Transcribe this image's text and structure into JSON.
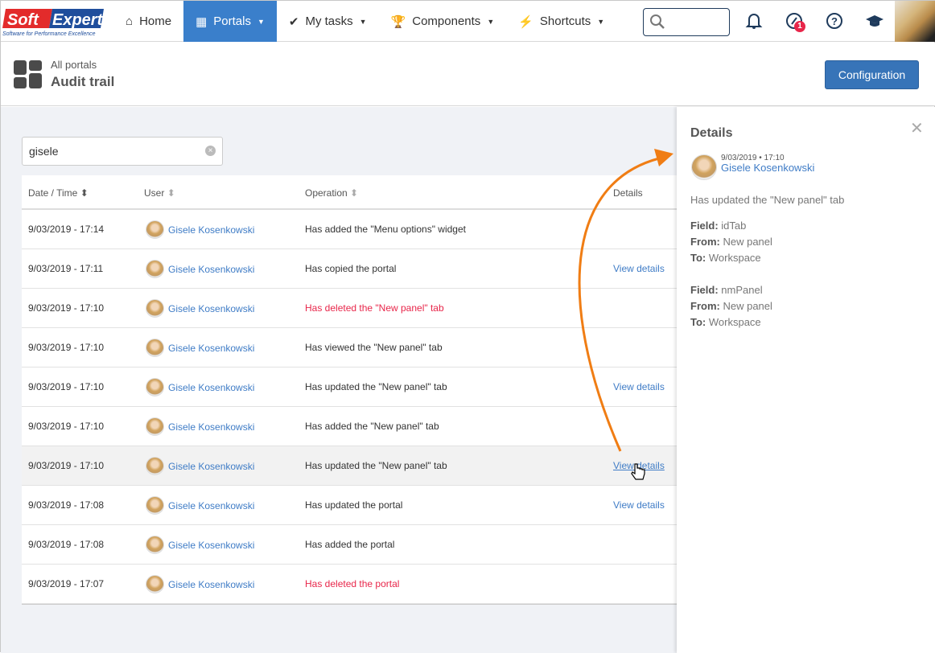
{
  "brand": {
    "logo_text_1": "Soft",
    "logo_text_2": "Expert",
    "tagline": "Software for Performance Excellence"
  },
  "nav": [
    {
      "label": "Home",
      "icon": "home-icon"
    },
    {
      "label": "Portals",
      "icon": "portals-icon",
      "active": true,
      "caret": "▼"
    },
    {
      "label": "My tasks",
      "icon": "check-icon",
      "caret": "▼"
    },
    {
      "label": "Components",
      "icon": "trophy-icon",
      "caret": "▼"
    },
    {
      "label": "Shortcuts",
      "icon": "bolt-icon",
      "caret": "▼"
    }
  ],
  "topbar": {
    "search_placeholder": "",
    "notification_badge": "1"
  },
  "header": {
    "breadcrumb": "All portals",
    "title": "Audit trail",
    "config_button": "Configuration"
  },
  "filter": {
    "value": "gisele"
  },
  "table": {
    "columns": [
      "Date / Time",
      "User",
      "Operation",
      "Details"
    ],
    "rows": [
      {
        "date": "9/03/2019 - 17:14",
        "user": "Gisele Kosenkowski",
        "operation": "Has added the \"Menu options\" widget",
        "details": "",
        "deleted": false
      },
      {
        "date": "9/03/2019 - 17:11",
        "user": "Gisele Kosenkowski",
        "operation": "Has copied the portal",
        "details": "View details",
        "deleted": false
      },
      {
        "date": "9/03/2019 - 17:10",
        "user": "Gisele Kosenkowski",
        "operation": "Has deleted the \"New panel\" tab",
        "details": "",
        "deleted": true
      },
      {
        "date": "9/03/2019 - 17:10",
        "user": "Gisele Kosenkowski",
        "operation": "Has viewed the \"New panel\" tab",
        "details": "",
        "deleted": false
      },
      {
        "date": "9/03/2019 - 17:10",
        "user": "Gisele Kosenkowski",
        "operation": "Has updated the \"New panel\" tab",
        "details": "View details",
        "deleted": false
      },
      {
        "date": "9/03/2019 - 17:10",
        "user": "Gisele Kosenkowski",
        "operation": "Has added the \"New panel\" tab",
        "details": "",
        "deleted": false
      },
      {
        "date": "9/03/2019 - 17:10",
        "user": "Gisele Kosenkowski",
        "operation": "Has updated the \"New panel\" tab",
        "details": "View details",
        "deleted": false,
        "highlighted": true
      },
      {
        "date": "9/03/2019 - 17:08",
        "user": "Gisele Kosenkowski",
        "operation": "Has updated the portal",
        "details": "View details",
        "deleted": false
      },
      {
        "date": "9/03/2019 - 17:08",
        "user": "Gisele Kosenkowski",
        "operation": "Has added the portal",
        "details": "",
        "deleted": false
      },
      {
        "date": "9/03/2019 - 17:07",
        "user": "Gisele Kosenkowski",
        "operation": "Has deleted the portal",
        "details": "",
        "deleted": true
      }
    ]
  },
  "panel": {
    "title": "Details",
    "date": "9/03/2019 • 17:10",
    "user": "Gisele Kosenkowski",
    "operation": "Has updated the \"New panel\" tab",
    "changes": [
      {
        "field": "idTab",
        "from": "New panel",
        "to": "Workspace"
      },
      {
        "field": "nmPanel",
        "from": "New panel",
        "to": "Workspace"
      }
    ],
    "labels": {
      "field": "Field:",
      "from": "From:",
      "to": "To:"
    }
  },
  "colors": {
    "accent": "#3a7fcb",
    "link": "#3f7cc6",
    "deleted": "#e8264a",
    "annotation": "#f07d14"
  }
}
